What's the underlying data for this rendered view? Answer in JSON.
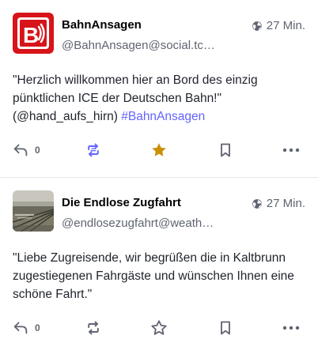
{
  "posts": [
    {
      "display_name": "BahnAnsagen",
      "handle": "@BahnAnsagen@social.tchncs.de",
      "handle_visible": "@BahnAnsagen@social.tc…",
      "visibility_icon": "globe-icon",
      "time": "27 Min.",
      "content_text": "\"Herzlich willkommen hier an Bord des einzig pünktlichen ICE der Deutschen Bahn!\" (@hand_aufs_hirn) ",
      "hashtag": "#BahnAnsagen",
      "reply_count": "0",
      "boosted": true,
      "favourited": true
    },
    {
      "display_name": "Die Endlose Zugfahrt",
      "handle": "@endlosezugfahrt@weath…",
      "handle_visible": "@endlosezugfahrt@weath…",
      "visibility_icon": "globe-icon",
      "time": "27 Min.",
      "content_text": "\"Liebe Zugreisende, wir begrüßen die in Kaltbrunn zugestiegenen Fahrgäste und wünschen Ihnen eine schöne Fahrt.\"",
      "hashtag": "",
      "reply_count": "0",
      "boosted": false,
      "favourited": false
    }
  ],
  "colors": {
    "accent": "#6364ff",
    "favourite": "#ca8f04",
    "icon_default": "#5f6470",
    "avatar_red": "#d7141a"
  }
}
